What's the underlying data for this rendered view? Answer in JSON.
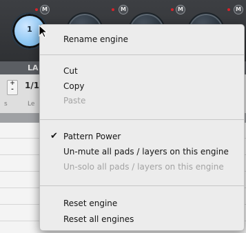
{
  "engines": [
    {
      "number": "1",
      "active": true,
      "mute_label": "M"
    },
    {
      "number": "",
      "active": false,
      "mute_label": "M"
    },
    {
      "number": "",
      "active": false,
      "mute_label": "M"
    },
    {
      "number": "",
      "active": false,
      "mute_label": "M"
    }
  ],
  "panel": {
    "section_label": "LA",
    "plus_minus": "+\n-",
    "fraction_value": "1/1",
    "small_label_s": "s",
    "small_label_le": "Le"
  },
  "context_menu": {
    "groups": [
      [
        {
          "label": "Rename engine",
          "enabled": true
        }
      ],
      [
        {
          "label": "Cut",
          "enabled": true
        },
        {
          "label": "Copy",
          "enabled": true
        },
        {
          "label": "Paste",
          "enabled": false
        }
      ],
      [
        {
          "label": "Pattern Power",
          "enabled": true,
          "checked": true
        },
        {
          "label": "Un-mute all pads / layers on this engine",
          "enabled": true
        },
        {
          "label": "Un-solo all pads / layers on this engine",
          "enabled": false
        }
      ],
      [
        {
          "label": "Reset engine",
          "enabled": true
        },
        {
          "label": "Reset all engines",
          "enabled": true
        }
      ]
    ],
    "checkmark": "✔"
  },
  "colors": {
    "active_knob": "#8ec8f4",
    "mute_dot": "#d8232a",
    "menu_bg": "#ececec",
    "disabled_text": "#a3a3a3"
  }
}
